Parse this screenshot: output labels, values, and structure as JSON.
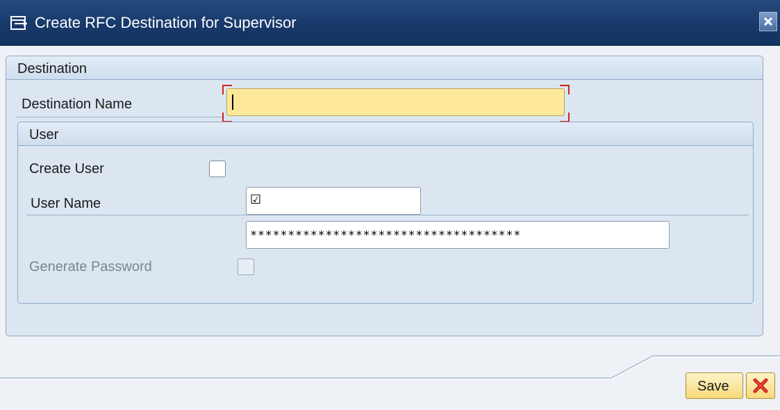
{
  "window": {
    "title": "Create RFC Destination for Supervisor",
    "title_icon": "edit-document-icon",
    "close_icon": "close-icon"
  },
  "destination_group": {
    "title": "Destination",
    "destination_name_label": "Destination Name",
    "destination_name_value": ""
  },
  "user_group": {
    "title": "User",
    "create_user_label": "Create User",
    "create_user_checked": false,
    "user_name_label": "User Name",
    "user_name_value": "☑",
    "password_value": "************************************",
    "generate_password_label": "Generate Password",
    "generate_password_checked": false
  },
  "footer": {
    "save_label": "Save",
    "cancel_icon": "cancel-icon"
  },
  "colors": {
    "title_bar": "#17396a",
    "required_field": "#fde89a",
    "required_bracket": "#d0241b",
    "group_bg": "#dbe6f1",
    "button_bg": "#f6d979"
  }
}
